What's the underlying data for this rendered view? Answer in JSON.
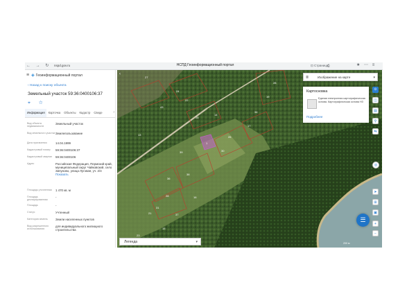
{
  "browser": {
    "nav_icons": "←  →  ↻",
    "url": "nspd.gov.ru",
    "tab_title": "НСПД Геоинформационный портал",
    "toolbar_left": "⊡ Страница",
    "toolbar_right": "⎙",
    "icons": "★ ⋯ ≡"
  },
  "sidebar": {
    "burger": "≡",
    "logo": "◈",
    "app_name": "Геоинформационный портал",
    "back_link": "‹  Назад к поиску объекта",
    "object_title": "Земельный участок 59:36:0400106:37",
    "actions": "⌖ ☆",
    "tabs": [
      "Информация",
      "Карточка",
      "Объекты",
      "Кадастр",
      "Сведе"
    ],
    "tab_more": "›",
    "rows": [
      {
        "key": "Вид объекта недвижимости",
        "value": "Земельный участок"
      },
      {
        "key": "Вид земельного участка",
        "value": "Землепользование"
      },
      {
        "key": "Дата присвоения",
        "value": "14.04.1999"
      },
      {
        "key": "Кадастровый номер",
        "value": "59:36:0400106:37"
      },
      {
        "key": "Кадастровый квартал",
        "value": "59:36:0400106"
      },
      {
        "key": "Адрес",
        "value": "Российская Федерация, Пермский край, муниципальный округ Чайковский, село Зипуново, улица Луговая, уч. 2/4",
        "link": "Показать"
      },
      {
        "key": "Площадь уточненная",
        "value": "1 470 кв. м"
      },
      {
        "key": "Площадь декларированная",
        "value": "-"
      },
      {
        "key": "Площадь",
        "value": "-"
      },
      {
        "key": "Статус",
        "value": "Учтенный"
      },
      {
        "key": "Категория земель",
        "value": "Земли населенных пунктов"
      },
      {
        "key": "Вид разрешенного использования",
        "value": "для индивидуального жилищного строительства"
      }
    ]
  },
  "map": {
    "layer_select": "Изображение на карте",
    "layer_icon": "≣",
    "caret": "▾",
    "cadastral_card_title": "Картосновка",
    "cadastral_card_text": "Единая электронная картографическая основа. Картографическая основа НЗ",
    "cadastral_card_link": "Подробнее",
    "legend_label": "Легенда",
    "scale_text": "200 м",
    "collapse_icon": "‹",
    "parcel_labels": [
      "24",
      "43",
      "22",
      "14",
      "25",
      "28",
      "19",
      "17",
      "36",
      "38",
      "31",
      "28",
      "1",
      "30",
      "26",
      "39",
      "21",
      "37",
      "34",
      "27",
      "13",
      "16",
      "23",
      "15"
    ],
    "right_tools_top": [
      "⊙",
      "◫",
      "▤",
      "⚲",
      "⇆",
      "⎆"
    ],
    "right_tools_bottom": [
      "➤",
      "⊞",
      "▣",
      "+",
      "−"
    ],
    "chat_icon": "☰",
    "assist_icon": "◎"
  },
  "colors": {
    "accent": "#2c7fd1",
    "parcel_outline": "#c0392b",
    "selected_parcel": "#c060c8",
    "water": "#8ba6a8",
    "forest": "#3b5a2a"
  }
}
